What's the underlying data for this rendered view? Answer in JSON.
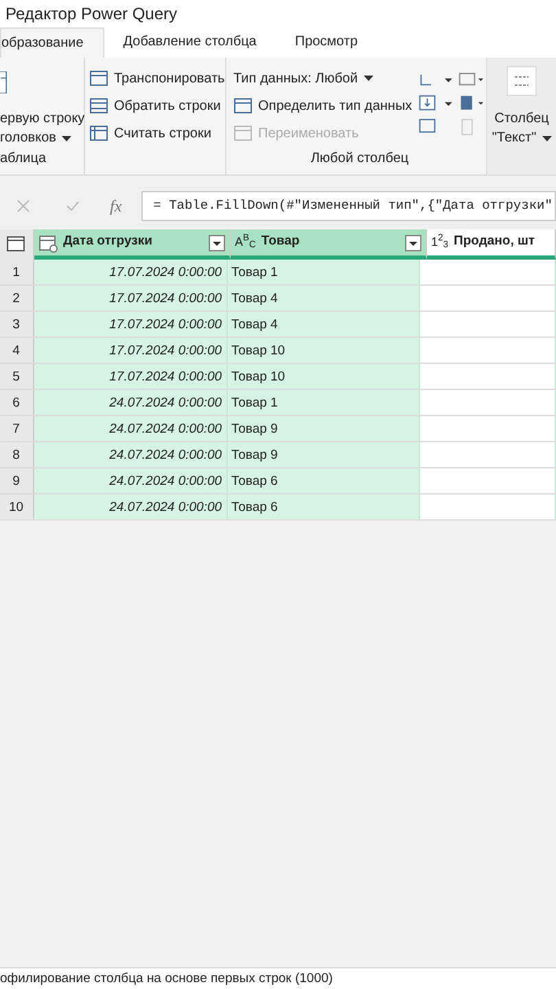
{
  "window": {
    "title": "Редактор Power Query"
  },
  "tabs": [
    {
      "label": "образование",
      "selected": true
    },
    {
      "label": "Добавление столбца",
      "selected": false
    },
    {
      "label": "Просмотр",
      "selected": false
    }
  ],
  "ribbon": {
    "groups": [
      {
        "label": "аблица",
        "items": [
          {
            "label": "ервую строку"
          },
          {
            "label": "головков",
            "dropdown": true
          }
        ]
      },
      {
        "items": [
          {
            "label": "Транспонировать",
            "kind": "transpose",
            "disabled": false
          },
          {
            "label": "Обратить строки",
            "kind": "reverse",
            "disabled": false
          },
          {
            "label": "Считать строки",
            "kind": "count",
            "disabled": false
          }
        ]
      },
      {
        "label": "Любой столбец",
        "items": [
          {
            "label": "Тип данных: Любой",
            "kind": "type",
            "disabled": false,
            "dropdown": true
          },
          {
            "label": "Определить тип данных",
            "kind": "detect",
            "disabled": false,
            "dropdown": false
          },
          {
            "label": "Переименовать",
            "kind": "rename",
            "disabled": true,
            "dropdown": false
          }
        ]
      },
      {
        "items": [
          {
            "label": "Столбец",
            "dropdown": false
          },
          {
            "label": "\"Текст\"",
            "dropdown": true
          }
        ]
      }
    ]
  },
  "formula_bar": {
    "fx": "fx",
    "formula": "= Table.FillDown(#\"Измененный тип\",{\"Дата отгрузки\""
  },
  "table": {
    "columns": [
      {
        "name": "Дата отгрузки",
        "kind": "date",
        "selected": true,
        "filter": true
      },
      {
        "name": "Товар",
        "kind": "text",
        "type_label": "A$^{B}$$_{C}$",
        "selected": true,
        "filter": true
      },
      {
        "name": "Продано, шт",
        "kind": "number",
        "type_label": "1$^{2}$$_{3}$",
        "selected": false,
        "filter": false
      }
    ],
    "rows": [
      {
        "n": "1",
        "cells": [
          "17.07.2024 0:00:00",
          "Товар 1",
          ""
        ]
      },
      {
        "n": "2",
        "cells": [
          "17.07.2024 0:00:00",
          "Товар 4",
          ""
        ]
      },
      {
        "n": "3",
        "cells": [
          "17.07.2024 0:00:00",
          "Товар 4",
          ""
        ]
      },
      {
        "n": "4",
        "cells": [
          "17.07.2024 0:00:00",
          "Товар 10",
          ""
        ]
      },
      {
        "n": "5",
        "cells": [
          "17.07.2024 0:00:00",
          "Товар 10",
          ""
        ]
      },
      {
        "n": "6",
        "cells": [
          "24.07.2024 0:00:00",
          "Товар 1",
          ""
        ]
      },
      {
        "n": "7",
        "cells": [
          "24.07.2024 0:00:00",
          "Товар 9",
          ""
        ]
      },
      {
        "n": "8",
        "cells": [
          "24.07.2024 0:00:00",
          "Товар 9",
          ""
        ]
      },
      {
        "n": "9",
        "cells": [
          "24.07.2024 0:00:00",
          "Товар 6",
          ""
        ]
      },
      {
        "n": "10",
        "cells": [
          "24.07.2024 0:00:00",
          "Товар 6",
          ""
        ]
      }
    ]
  },
  "status_bar": {
    "text": "офилирование столбца на основе первых строк (1000)"
  }
}
